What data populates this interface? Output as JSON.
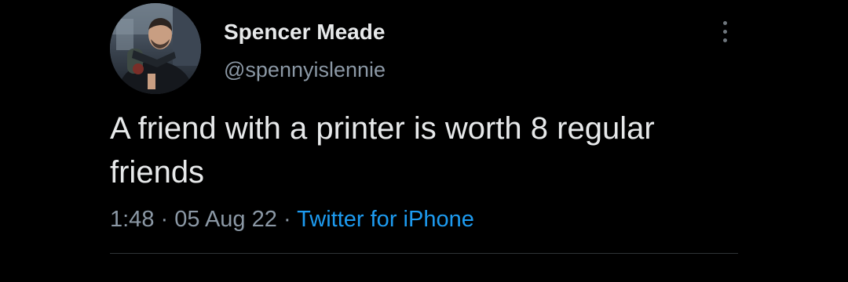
{
  "tweet": {
    "author": {
      "display_name": "Spencer Meade",
      "handle": "@spennyislennie",
      "avatar_icon": "profile-photo"
    },
    "text": "A friend with a printer is worth 8 regular friends",
    "time": "1:48",
    "separator": "·",
    "date": "05 Aug 22",
    "source": "Twitter for iPhone",
    "more_icon": "vertical-ellipsis-icon"
  },
  "colors": {
    "background": "#000000",
    "primary_text": "#e7e9ea",
    "secondary_text": "#8b98a5",
    "link": "#1d9bf0",
    "divider": "#2f3336"
  }
}
